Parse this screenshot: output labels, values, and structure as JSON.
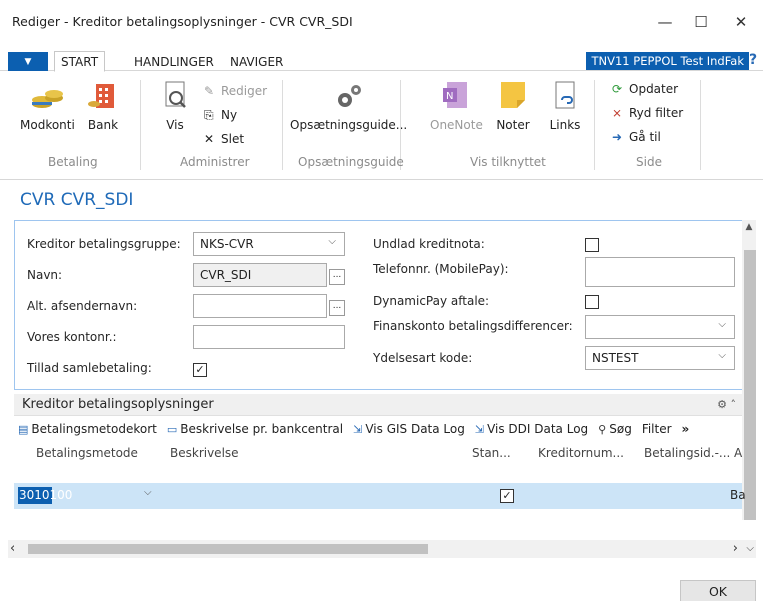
{
  "window": {
    "title": "Rediger - Kreditor betalingsoplysninger - CVR CVR_SDI",
    "minimize_glyph": "—",
    "maximize_glyph": "☐",
    "close_glyph": "✕"
  },
  "tabs": {
    "app_menu_glyph": "▼",
    "items": [
      "START",
      "HANDLINGER",
      "NAVIGER"
    ],
    "company": "TNV11 PEPPOL Test IndFak",
    "help_glyph": "?"
  },
  "ribbon": {
    "groups": [
      "Betaling",
      "Administrer",
      "Opsætningsguide",
      "Vis tilknyttet",
      "Side"
    ],
    "modkonti": "Modkonti",
    "bank": "Bank",
    "vis": "Vis",
    "rediger": "Rediger",
    "ny": "Ny",
    "slet": "Slet",
    "opsaetningsguide": "Opsætningsguide...",
    "onenote": "OneNote",
    "noter": "Noter",
    "links": "Links",
    "opdater": "Opdater",
    "ryd_filter": "Ryd filter",
    "gaa_til": "Gå til"
  },
  "page": {
    "title": "CVR CVR_SDI"
  },
  "form": {
    "kreditor_betalingsgruppe_label": "Kreditor betalingsgruppe:",
    "kreditor_betalingsgruppe_value": "NKS-CVR",
    "navn_label": "Navn:",
    "navn_value": "CVR_SDI",
    "alt_afsendernavn_label": "Alt. afsendernavn:",
    "vores_kontonr_label": "Vores kontonr.:",
    "tillad_samlebetaling_label": "Tillad samlebetaling:",
    "undlad_kreditnota_label": "Undlad kreditnota:",
    "telefonnr_label": "Telefonnr. (MobilePay):",
    "dynamicpay_label": "DynamicPay aftale:",
    "finanskonto_label": "Finanskonto betalingsdifferencer:",
    "ydelsesart_label": "Ydelsesart kode:",
    "ydelsesart_value": "NSTEST",
    "ellipsis": "...",
    "check": "✓",
    "dropdown_glyph": "⌵"
  },
  "part": {
    "title": "Kreditor betalingsoplysninger",
    "actions": [
      "Betalingsmetodekort",
      "Beskrivelse pr. bankcentral",
      "Vis GIS Data Log",
      "Vis DDI Data Log",
      "Søg",
      "Filter"
    ],
    "more_glyph": "»",
    "columns": [
      "Betalingsmetode",
      "Beskrivelse",
      "Stan...",
      "Kreditornum...",
      "Betalingsid.-...",
      "A"
    ],
    "row": {
      "betalingsmetode": "3010100",
      "last_cell": "Ba"
    }
  },
  "footer": {
    "ok": "OK"
  }
}
